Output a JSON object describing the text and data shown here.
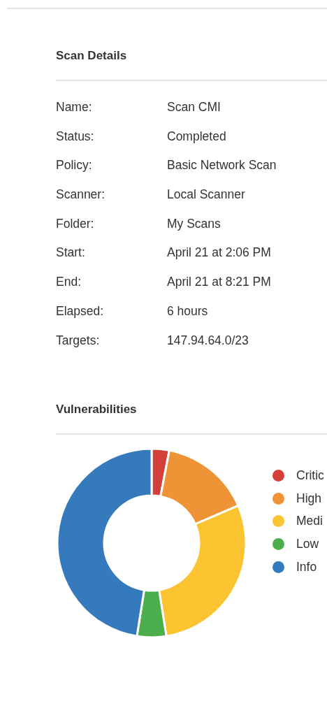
{
  "scan_details": {
    "title": "Scan Details",
    "rows": [
      {
        "label": "Name:",
        "value": "Scan CMI"
      },
      {
        "label": "Status:",
        "value": "Completed"
      },
      {
        "label": "Policy:",
        "value": "Basic Network Scan"
      },
      {
        "label": "Scanner:",
        "value": "Local Scanner"
      },
      {
        "label": "Folder:",
        "value": "My Scans"
      },
      {
        "label": "Start:",
        "value": "April 21 at 2:06 PM"
      },
      {
        "label": "End:",
        "value": "April 21 at 8:21 PM"
      },
      {
        "label": "Elapsed:",
        "value": "6 hours"
      },
      {
        "label": "Targets:",
        "value": "147.94.64.0/23"
      }
    ]
  },
  "vulnerabilities": {
    "title": "Vulnerabilities",
    "legend": [
      {
        "label": "Critic",
        "color": "#d43f3a"
      },
      {
        "label": "High",
        "color": "#ee9336"
      },
      {
        "label": "Medi",
        "color": "#fdc431"
      },
      {
        "label": "Low",
        "color": "#4cae4c"
      },
      {
        "label": "Info",
        "color": "#357abd"
      }
    ]
  }
}
